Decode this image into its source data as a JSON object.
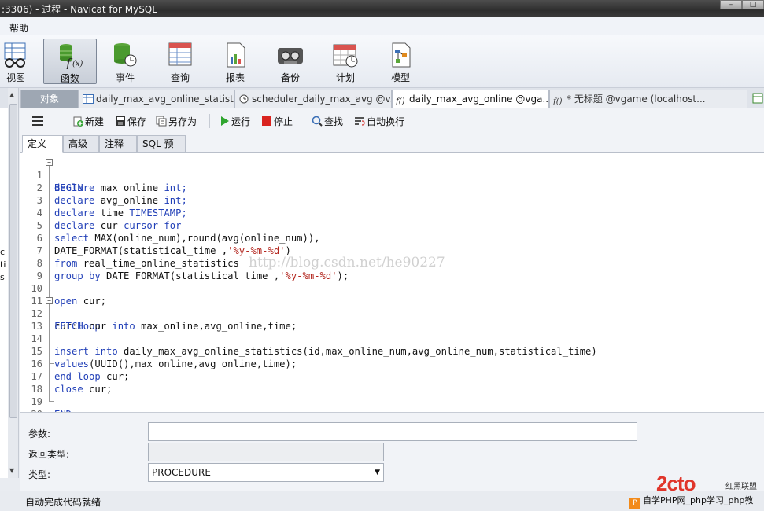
{
  "window": {
    "title": ":3306) - 过程 - Navicat for MySQL"
  },
  "menu": {
    "help": "帮助"
  },
  "toolbar": {
    "view": "视图",
    "function": "函数",
    "event": "事件",
    "query": "查询",
    "report": "报表",
    "backup": "备份",
    "schedule": "计划",
    "model": "模型"
  },
  "tabs": [
    {
      "label": "对象"
    },
    {
      "label": "daily_max_avg_online_statist..."
    },
    {
      "label": "scheduler_daily_max_avg @v..."
    },
    {
      "label": "daily_max_avg_online @vga..."
    },
    {
      "label": "* 无标题 @vgame (localhost..."
    }
  ],
  "editor_toolbar": {
    "new": "新建",
    "save": "保存",
    "save_as": "另存为",
    "run": "运行",
    "stop": "停止",
    "find": "查找",
    "wrap": "自动换行"
  },
  "subtabs": {
    "definition": "定义",
    "advanced": "高级",
    "comment": "注释",
    "sql_preview": "SQL 预览"
  },
  "left_strip": [
    "c",
    "ti",
    "s"
  ],
  "code": {
    "l1": "BEGIN",
    "l2a": "declare",
    "l2b": " max_online ",
    "l2c": "int;",
    "l3a": "declare",
    "l3b": " avg_online ",
    "l3c": "int;",
    "l4a": "declare",
    "l4b": " time ",
    "l4c": "TIMESTAMP;",
    "l5a": "declare",
    "l5b": " cur ",
    "l5c": "cursor for",
    "l6a": "select",
    "l6b": " MAX(online_num),round(avg(online_num)),",
    "l7a": "DATE_FORMAT(statistical_time ,",
    "l7b": "'%y-%m-%d'",
    "l7c": ")",
    "l8a": "from",
    "l8b": " real_time_online_statistics",
    "l9a": "group by",
    "l9b": " DATE_FORMAT(statistical_time ,",
    "l9c": "'%y-%m-%d'",
    "l9d": ");",
    "l11a": "open",
    "l11b": " cur;",
    "l12a": "cur:",
    "l12b": "loop",
    "l13a": "FETCH",
    "l13b": " cur ",
    "l13c": "into",
    "l13d": " max_online,avg_online,time;",
    "l15a": "insert into",
    "l15b": " daily_max_avg_online_statistics(id,max_online_num,avg_online_num,statistical_time)",
    "l16a": "values",
    "l16b": "(UUID(),max_online,avg_online,time);",
    "l17a": "end loop",
    "l17b": " cur;",
    "l18a": "close",
    "l18b": " cur;",
    "l20": "END"
  },
  "watermark": "http://blog.csdn.net/he90227",
  "props": {
    "params_label": "参数:",
    "params_value": "",
    "return_label": "返回类型:",
    "return_value": "",
    "type_label": "类型:",
    "type_value": "PROCEDURE"
  },
  "status": {
    "text": "自动完成代码就绪"
  },
  "branding": {
    "logo": "2cto",
    "sub": "红黑联盟",
    "footer": "自学PHP网_php学习_php教"
  }
}
